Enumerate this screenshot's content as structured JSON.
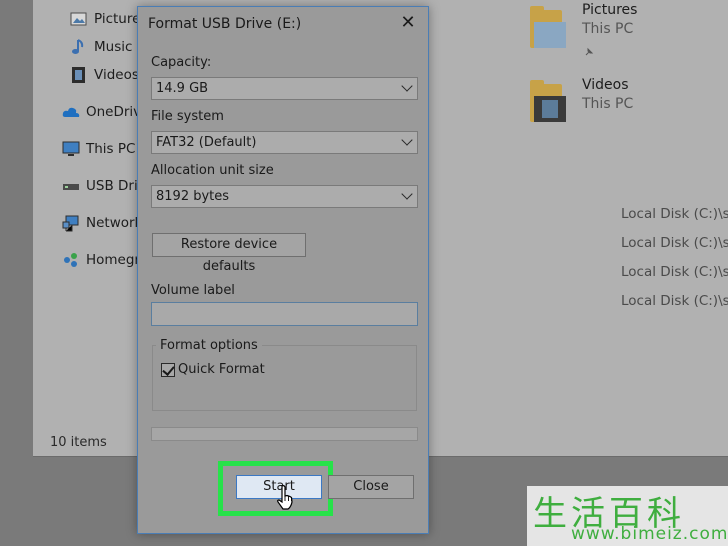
{
  "explorer": {
    "nav": {
      "pictures": "Pictures",
      "music": "Music",
      "videos": "Videos",
      "onedrive": "OneDrive",
      "this_pc": "This PC",
      "usb_drive": "USB Drive",
      "network": "Network",
      "homegroup": "Homegroup"
    },
    "tiles": [
      {
        "title": "Pictures",
        "sub": "This PC"
      },
      {
        "title": "Videos",
        "sub": "This PC"
      }
    ],
    "paths": [
      "Local Disk (C:)\\sar",
      "Local Disk (C:)\\sar",
      "Local Disk (C:)\\sar",
      "Local Disk (C:)\\sar"
    ],
    "status": "10 items"
  },
  "dialog": {
    "title": "Format USB Drive (E:)",
    "capacity_label": "Capacity:",
    "capacity_value": "14.9 GB",
    "filesystem_label": "File system",
    "filesystem_value": "FAT32 (Default)",
    "allocation_label": "Allocation unit size",
    "allocation_value": "8192 bytes",
    "restore_label": "Restore device defaults",
    "volume_label": "Volume label",
    "volume_value": "",
    "options_label": "Format options",
    "quick_format_label": "Quick Format",
    "quick_format_checked": true,
    "progress_fraction": 0,
    "start_label": "Start",
    "close_label": "Close"
  },
  "colors": {
    "highlight": "#27e24a",
    "accent": "#3b78c4",
    "watermark": "#3fae3f"
  },
  "watermark": {
    "cn": "生活百科",
    "url": "www.bimeiz.com"
  }
}
